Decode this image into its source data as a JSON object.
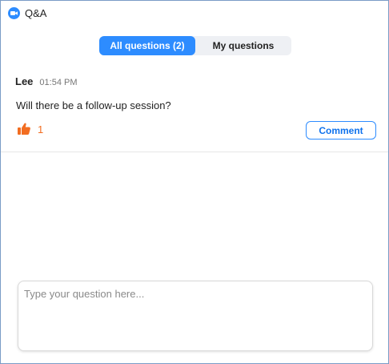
{
  "window": {
    "title": "Q&A",
    "icon": "zoom-camera-icon",
    "accent_color": "#2d8cff"
  },
  "tabs": [
    {
      "label": "All questions (2)",
      "active": true
    },
    {
      "label": "My questions",
      "active": false
    }
  ],
  "questions": [
    {
      "author": "Lee",
      "time": "01:54 PM",
      "text": "Will there be a follow-up session?",
      "likes": "1",
      "like_icon": "thumbs-up-icon",
      "like_color": "#f26d21",
      "comment_label": "Comment"
    }
  ],
  "composer": {
    "placeholder": "Type your question here..."
  }
}
